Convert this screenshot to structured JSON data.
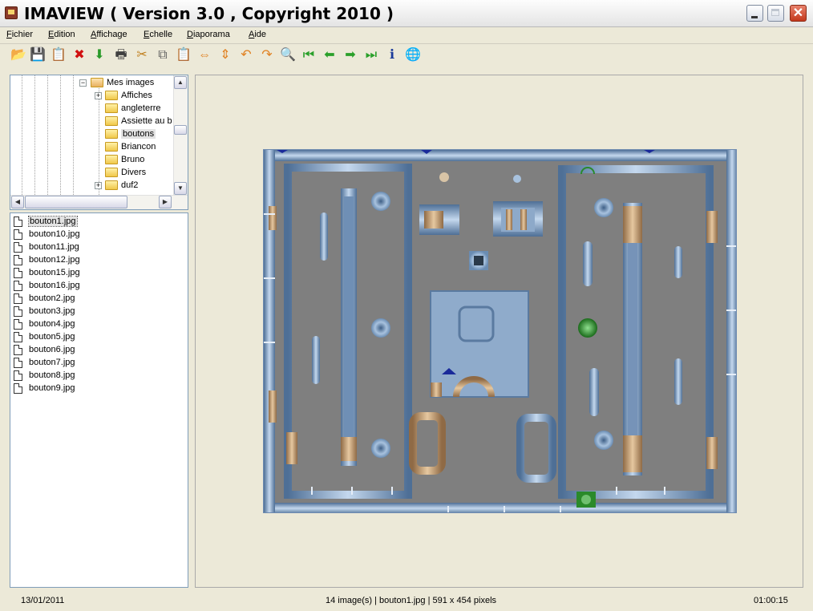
{
  "window": {
    "title": "IMAVIEW ( Version 3.0 , Copyright 2010 )",
    "close_glyph": "✕"
  },
  "menu": [
    "Fichier",
    "Edition",
    "Affichage",
    "Echelle",
    "Diaporama",
    "Aide"
  ],
  "toolbar": [
    {
      "name": "open-icon",
      "glyph": "📂"
    },
    {
      "name": "save-icon",
      "glyph": "💾"
    },
    {
      "name": "properties-icon",
      "glyph": "📋"
    },
    {
      "name": "delete-icon",
      "glyph": "✖"
    },
    {
      "name": "download-icon",
      "glyph": "⬇"
    },
    {
      "name": "print-icon",
      "glyph": "🖶"
    },
    {
      "name": "cut-icon",
      "glyph": "✂"
    },
    {
      "name": "copy-icon",
      "glyph": "⧉"
    },
    {
      "name": "paste-icon",
      "glyph": "📋"
    },
    {
      "name": "flip-horizontal-icon",
      "glyph": "⇔"
    },
    {
      "name": "flip-vertical-icon",
      "glyph": "⇕"
    },
    {
      "name": "rotate-left-icon",
      "glyph": "↶"
    },
    {
      "name": "rotate-right-icon",
      "glyph": "↷"
    },
    {
      "name": "zoom-icon",
      "glyph": "🔍"
    },
    {
      "name": "first-image-icon",
      "glyph": "⏮"
    },
    {
      "name": "previous-image-icon",
      "glyph": "⬅"
    },
    {
      "name": "next-image-icon",
      "glyph": "➡"
    },
    {
      "name": "last-image-icon",
      "glyph": "⏭"
    },
    {
      "name": "info-icon",
      "glyph": "ℹ"
    },
    {
      "name": "web-icon",
      "glyph": "🌐"
    }
  ],
  "tree": {
    "root": "Mes images",
    "items": [
      {
        "label": "Affiches",
        "expandable": true
      },
      {
        "label": "angleterre",
        "expandable": false
      },
      {
        "label": "Assiette au b",
        "expandable": false
      },
      {
        "label": "boutons",
        "expandable": false,
        "selected": true
      },
      {
        "label": "Briancon",
        "expandable": false
      },
      {
        "label": "Bruno",
        "expandable": false
      },
      {
        "label": "Divers",
        "expandable": false
      },
      {
        "label": "duf2",
        "expandable": true
      }
    ],
    "scroll_up": "▲",
    "scroll_down": "▼",
    "scroll_left": "◀",
    "scroll_right": "▶"
  },
  "files": [
    "bouton1.jpg",
    "bouton10.jpg",
    "bouton11.jpg",
    "bouton12.jpg",
    "bouton15.jpg",
    "bouton16.jpg",
    "bouton2.jpg",
    "bouton3.jpg",
    "bouton4.jpg",
    "bouton5.jpg",
    "bouton6.jpg",
    "bouton7.jpg",
    "bouton8.jpg",
    "bouton9.jpg"
  ],
  "selected_file": "bouton1.jpg",
  "status": {
    "date": "13/01/2011",
    "info": "14 image(s) | bouton1.jpg | 591 x 454 pixels",
    "time": "01:00:15"
  },
  "colors": {
    "frame_blue": "#7fa3c8",
    "tan": "#c8a278",
    "gray": "#808080",
    "green": "#2a8a2a",
    "navy": "#1a2a9a"
  }
}
